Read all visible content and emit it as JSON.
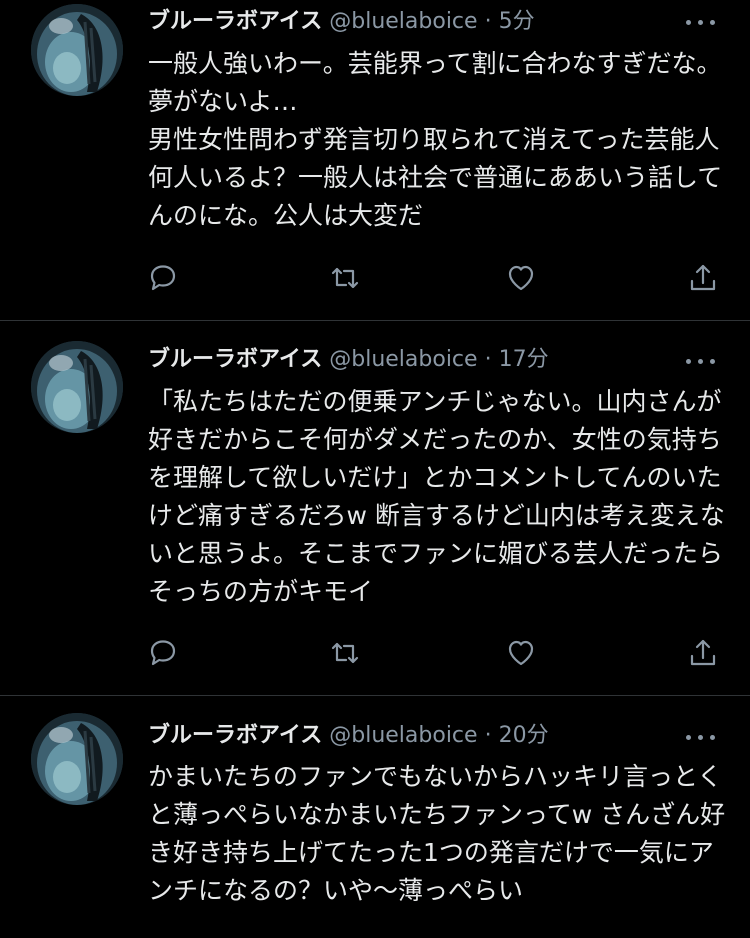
{
  "tweets": [
    {
      "name": "ブルーラボアイス",
      "handle": "@bluelaboice",
      "separator": "·",
      "time": "5分",
      "text": "一般人強いわー。芸能界って割に合わなすぎだな。夢がないよ…\n男性女性問わず発言切り取られて消えてった芸能人何人いるよ？一般人は社会で普通にああいう話してんのにな。公人は大変だ"
    },
    {
      "name": "ブルーラボアイス",
      "handle": "@bluelaboice",
      "separator": "·",
      "time": "17分",
      "text": "「私たちはただの便乗アンチじゃない。山内さんが好きだからこそ何がダメだったのか、女性の気持ちを理解して欲しいだけ」とかコメントしてんのいたけど痛すぎるだろw 断言するけど山内は考え変えないと思うよ。そこまでファンに媚びる芸人だったらそっちの方がキモイ"
    },
    {
      "name": "ブルーラボアイス",
      "handle": "@bluelaboice",
      "separator": "·",
      "time": "20分",
      "text": "かまいたちのファンでもないからハッキリ言っとくと薄っぺらいなかまいたちファンってw さんざん好き好き持ち上げてたった1つの発言だけで一気にアンチになるの？いや〜薄っぺらい"
    }
  ],
  "icons": {
    "reply": "reply-icon",
    "retweet": "retweet-icon",
    "like": "like-icon",
    "share": "share-icon",
    "more": "more-icon"
  },
  "colors": {
    "background": "#000000",
    "text": "#e7e9ea",
    "secondary": "#8b98a5",
    "divider": "#2f3336"
  }
}
